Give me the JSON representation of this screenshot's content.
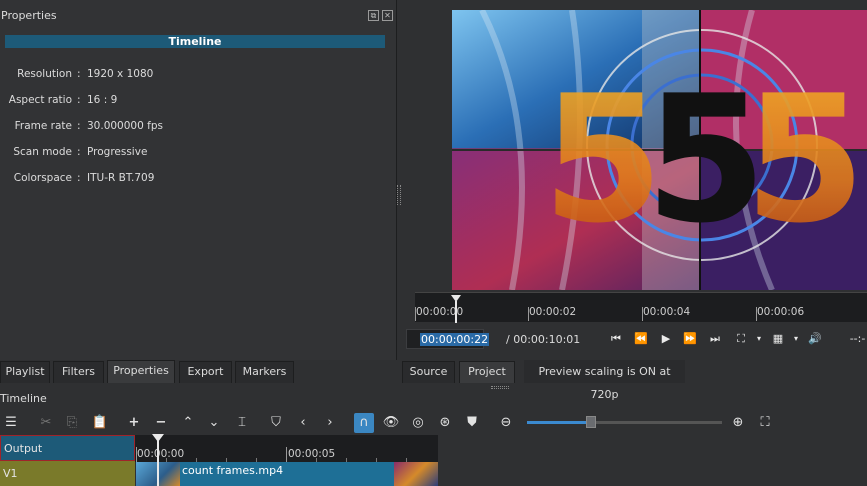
{
  "properties": {
    "title": "Properties",
    "header": "Timeline",
    "rows": [
      {
        "label": "Resolution",
        "value": "1920 x 1080"
      },
      {
        "label": "Aspect ratio",
        "value": "16 : 9"
      },
      {
        "label": "Frame rate",
        "value": "30.000000 fps"
      },
      {
        "label": "Scan mode",
        "value": "Progressive"
      },
      {
        "label": "Colorspace",
        "value": "ITU-R BT.709"
      }
    ]
  },
  "tabs": {
    "playlist": "Playlist",
    "filters": "Filters",
    "properties": "Properties",
    "export": "Export",
    "markers": "Markers"
  },
  "player": {
    "ruler_ticks": [
      "00:00:00",
      "00:00:02",
      "00:00:04",
      "00:00:06"
    ],
    "ruler_overflow": "--:-",
    "timecode": "00:00:00:22",
    "duration": "/ 00:00:10:01",
    "source_tab": "Source",
    "project_tab": "Project",
    "preview_scaling": "Preview scaling is ON at 720p",
    "preview_digit": "5"
  },
  "timeline": {
    "title": "Timeline",
    "ruler_ticks": [
      "00:00:00",
      "00:00:05"
    ],
    "tracks": [
      {
        "name": "Output"
      },
      {
        "name": "V1"
      }
    ],
    "clip_name": "count frames.mp4",
    "zoom_level": 0.33
  },
  "colors": {
    "accent": "#3b87c2",
    "header_blue": "#1d5a78",
    "track_v1": "#7a7a2a"
  }
}
